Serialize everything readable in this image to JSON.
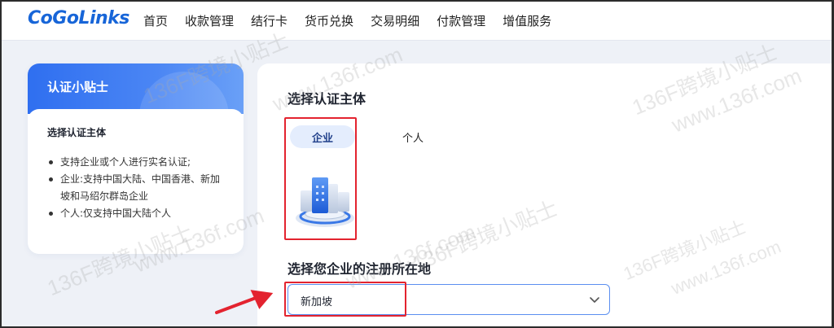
{
  "brand": {
    "logo_text": "CoGoLinks"
  },
  "nav": {
    "items": [
      "首页",
      "收款管理",
      "结行卡",
      "货币兑换",
      "交易明细",
      "付款管理",
      "增值服务"
    ]
  },
  "tips": {
    "title": "认证小贴士",
    "subtitle": "选择认证主体",
    "items": [
      "支持企业或个人进行实名认证;",
      "企业:支持中国大陆、中国香港、新加坡和马绍尔群岛企业",
      "个人:仅支持中国大陆个人"
    ]
  },
  "form": {
    "subject_title": "选择认证主体",
    "tabs": {
      "enterprise": "企业",
      "personal": "个人"
    },
    "location_title": "选择您企业的注册所在地",
    "location_value": "新加坡"
  },
  "watermark": {
    "text_site": "www.136f.com",
    "text_brand": "136F跨境小贴士"
  },
  "colors": {
    "primary": "#1765d8",
    "annotation_red": "#e3232f",
    "select_border": "#5b8ff0"
  }
}
